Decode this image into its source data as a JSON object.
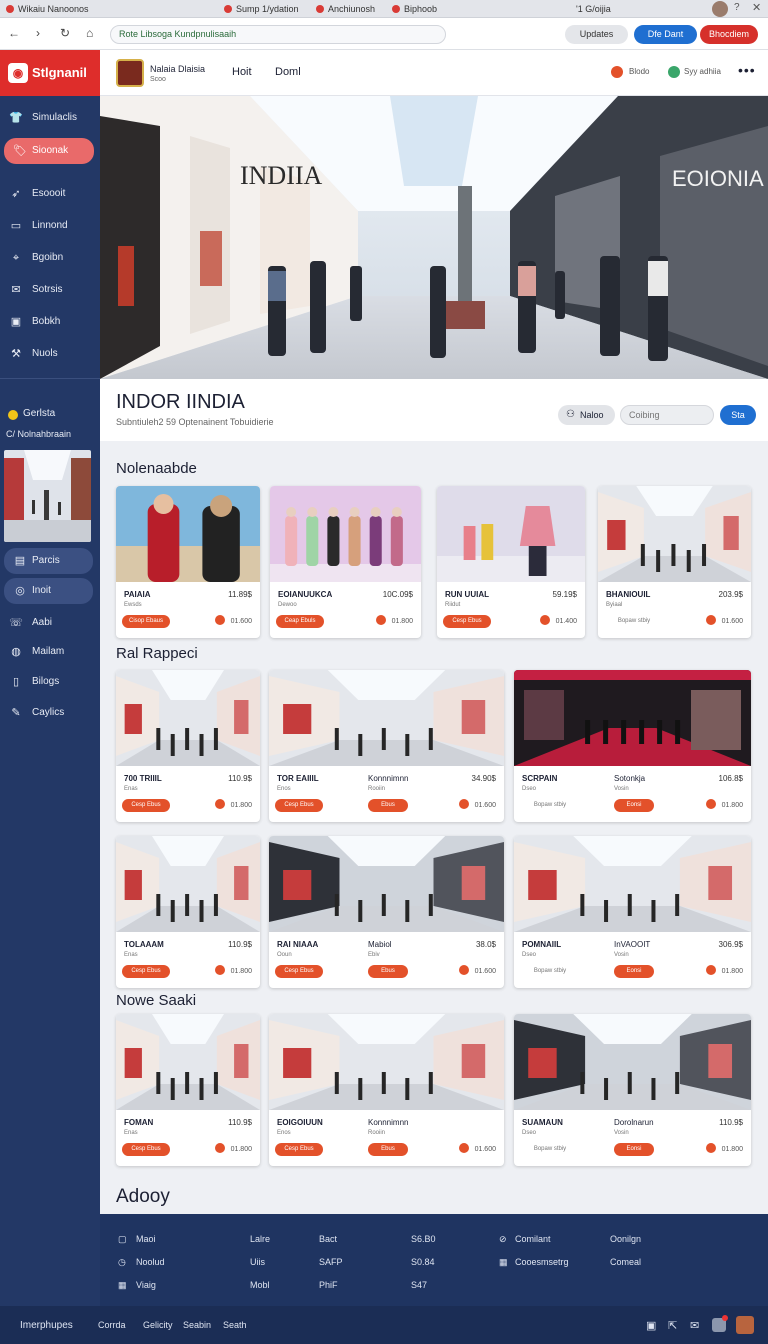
{
  "browser": {
    "tabs": [
      {
        "label": "Wikaiu Nanoonos"
      },
      {
        "label": "Sump 1/ydation"
      },
      {
        "label": "Anchiunosh"
      },
      {
        "label": "Biphoob"
      }
    ],
    "window_label": "'1 G/oijia",
    "url": "Rote Libsoga Kundpnulisaaih",
    "buttons": {
      "updates": "Updates",
      "primary": "Dfe Dant",
      "danger": "Bhocdiem"
    }
  },
  "sidebar": {
    "brand": "Stlgnanil",
    "items": [
      {
        "label": "Simulaclis",
        "icon": "shirt-icon"
      },
      {
        "label": "Sioonak",
        "icon": "tag-icon",
        "active": true
      },
      {
        "label": "Esoooit",
        "icon": "rocket-icon"
      },
      {
        "label": "Linnond",
        "icon": "store-icon"
      },
      {
        "label": "Bgoibn",
        "icon": "pin-icon"
      },
      {
        "label": "Sotrsis",
        "icon": "mail-icon"
      },
      {
        "label": "Bobkh",
        "icon": "image-icon"
      },
      {
        "label": "Nuols",
        "icon": "tools-icon"
      }
    ],
    "section_title": "Gerlsta",
    "section_sub": "C/ Nolnahbraain",
    "items2": [
      {
        "label": "Parcis",
        "icon": "building-icon"
      },
      {
        "label": "Inoit",
        "icon": "chat-icon"
      },
      {
        "label": "Aabi",
        "icon": "phone-icon"
      },
      {
        "label": "Mailam",
        "icon": "globe-icon"
      },
      {
        "label": "Bilogs",
        "icon": "doc-icon"
      },
      {
        "label": "Caylics",
        "icon": "bulb-icon"
      }
    ]
  },
  "topbar": {
    "brand_line1": "Nalaia Dlaisia",
    "brand_line2": "Scoo",
    "nav": [
      "Hoit",
      "Doml"
    ],
    "right1": "Blodo",
    "right2": "Syy adhiia"
  },
  "hero": {
    "store_sign_left": "INDIIA",
    "store_sign_right": "EOIONIA"
  },
  "page": {
    "title": "INDOR IINDIA",
    "subtitle": "Subntiuleh2 59 Optenainent  Tobuidierie",
    "filter_label": "Naloo",
    "search_placeholder": "Coibing",
    "go_label": "Sta"
  },
  "colors": {
    "sidebar": "#233866",
    "accent": "#de2d2b",
    "button": "#e3512a",
    "primary": "#1f6fd1"
  },
  "sections": [
    {
      "title": "Nolenaabde",
      "cards": [
        {
          "name": "PAIAIA",
          "price": "11.89$",
          "sub": "Ewsds",
          "btn": "Cisop Ebaus",
          "stat": "01.600",
          "scene": "people"
        },
        {
          "name": "EOIANUUKCA",
          "price": "10C.09$",
          "sub": "Dewoo",
          "btn": "Ceap Ebuls",
          "stat": "01.800",
          "scene": "mannequins"
        },
        {
          "name": "RUN UUIAL",
          "price": "59.19$",
          "sub": "Riidut",
          "btn": "Cesp Ebus",
          "stat": "01.400",
          "scene": "dress"
        },
        {
          "name": "BHANIOUIL",
          "price": "203.9$",
          "sub": "Byiaal",
          "btn": "Bopaw stbiy",
          "stat": "01.600",
          "scene": "mall",
          "btn_plain": true
        }
      ]
    },
    {
      "title": "Ral Rappeci",
      "cards": [
        {
          "name": "700 TRIIIL",
          "price": "110.9$",
          "sub": "Enas",
          "btn": "Cesp Ebus",
          "stat": "01.800",
          "scene": "mall"
        },
        {
          "name": "TOR EAIIIL",
          "mid": "Konnnimnn",
          "price": "34.90$",
          "sub": "Enos",
          "mid_sub": "Rooiin",
          "btn": "Cesp Ebus",
          "mid_btn": "Ebus",
          "stat": "01.600",
          "scene": "mall",
          "wide": true
        },
        {
          "name": "SCRPAIN",
          "mid": "Sotonkja",
          "price": "106.8$",
          "sub": "Dseo",
          "mid_sub": "Vosin",
          "btn": "Bopaw stbiy",
          "mid_btn": "Eonsi",
          "stat": "01.800",
          "scene": "red",
          "wide": true,
          "btn_plain": true
        }
      ]
    },
    {
      "title": "",
      "cards": [
        {
          "name": "TOLAAAM",
          "price": "110.9$",
          "sub": "Enas",
          "btn": "Cesp Ebus",
          "stat": "01.800",
          "scene": "mall"
        },
        {
          "name": "RAI NIAAA",
          "mid": "Mabiol",
          "price": "38.0$",
          "sub": "Ooun",
          "mid_sub": "Ebiv",
          "btn": "Cesp Ebus",
          "mid_btn": "Ebus",
          "stat": "01.600",
          "scene": "mall2",
          "wide": true
        },
        {
          "name": "POMNAIIL",
          "mid": "InVAOOIT",
          "price": "306.9$",
          "sub": "Dseo",
          "mid_sub": "Vosin",
          "btn": "Bopaw stbiy",
          "mid_btn": "Eonsi",
          "stat": "01.800",
          "scene": "mall",
          "wide": true,
          "btn_plain": true
        }
      ]
    },
    {
      "title": "Nowe Saaki",
      "cards": [
        {
          "name": "FOMAN",
          "price": "110.9$",
          "sub": "Enas",
          "btn": "Cesp Ebus",
          "stat": "01.800",
          "scene": "mall"
        },
        {
          "name": "EOIGOIUUN",
          "mid": "Konnnimnn",
          "price": "",
          "sub": "Enos",
          "mid_sub": "Rooiin",
          "btn": "Cesp Ebus",
          "mid_btn": "Ebus",
          "stat": "01.600",
          "scene": "mall",
          "wide": true
        },
        {
          "name": "SUAMAUN",
          "mid": "Dorolnarun",
          "price": "110.9$",
          "sub": "Dseo",
          "mid_sub": "Vosin",
          "btn": "Bopaw stbiy",
          "mid_btn": "Eonsi",
          "stat": "01.800",
          "scene": "mall2",
          "wide": true,
          "btn_plain": true
        }
      ]
    }
  ],
  "footer_heading": "Adooy",
  "footer": {
    "col1": [
      "Maoi",
      "Noolud",
      "Viaig"
    ],
    "col2": [
      "Lalre",
      "Uiis",
      "Mobl"
    ],
    "col3": [
      "Bact",
      "SAFP",
      "PhiF"
    ],
    "col4": [
      "S6.B0",
      "S0.84",
      "S47"
    ],
    "col5": [
      "Comilant",
      "Cooesmsetrg"
    ],
    "col6": [
      "Oonilgn",
      "Comeal"
    ]
  },
  "bottombar": [
    "Imerphupes",
    "Corrda",
    "Gelicity",
    "Seabin",
    "Seath"
  ]
}
